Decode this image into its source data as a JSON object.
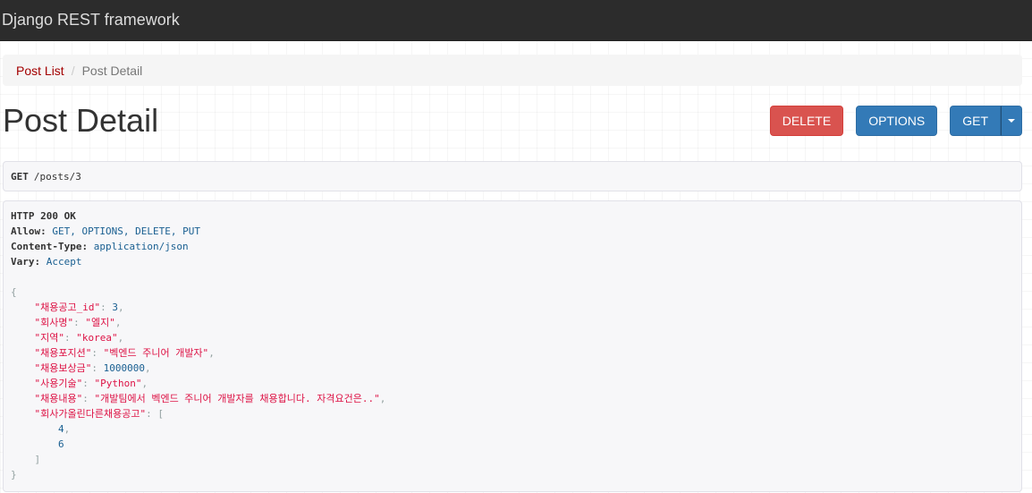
{
  "navbar": {
    "brand": "Django REST framework"
  },
  "breadcrumb": {
    "items": [
      "Post List",
      "Post Detail"
    ],
    "separator": "/"
  },
  "page": {
    "title": "Post Detail"
  },
  "buttons": {
    "delete": "DELETE",
    "options": "OPTIONS",
    "get": "GET"
  },
  "request": {
    "method": "GET",
    "path": "/posts/3"
  },
  "response": {
    "status": "HTTP 200 OK",
    "headers": [
      {
        "name": "Allow:",
        "value": "GET, OPTIONS, DELETE, PUT"
      },
      {
        "name": "Content-Type:",
        "value": "application/json"
      },
      {
        "name": "Vary:",
        "value": "Accept"
      }
    ],
    "body": {
      "fields": [
        {
          "key": "\"채용공고_id\"",
          "value": "3",
          "type": "num"
        },
        {
          "key": "\"회사명\"",
          "value": "\"엘지\"",
          "type": "str"
        },
        {
          "key": "\"지역\"",
          "value": "\"korea\"",
          "type": "str"
        },
        {
          "key": "\"채용포지션\"",
          "value": "\"벡엔드 주니어 개발자\"",
          "type": "str"
        },
        {
          "key": "\"채용보상금\"",
          "value": "1000000",
          "type": "num"
        },
        {
          "key": "\"사용기술\"",
          "value": "\"Python\"",
          "type": "str"
        },
        {
          "key": "\"채용내용\"",
          "value": "\"개발팀에서 벡엔드 주니어 개발자를 채용합니다. 자격요건은..\"",
          "type": "str"
        }
      ],
      "list_key": "\"회사가올린다른채용공고\"",
      "list_values": [
        "4",
        "6"
      ]
    }
  },
  "colors": {
    "navbar": "#2c2c2c",
    "delete": "#d9534f",
    "primary": "#337ab7",
    "link": "#a30000",
    "string": "#dd1144",
    "literal": "#195f91"
  }
}
